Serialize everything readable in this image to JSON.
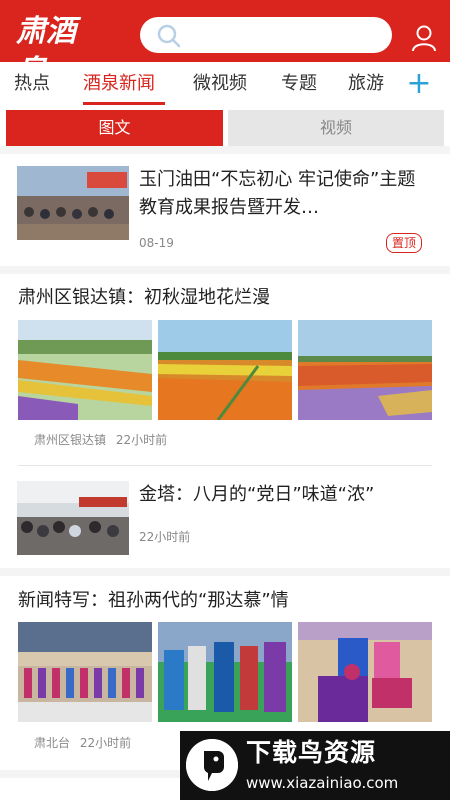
{
  "header": {
    "logo_text": "肃酒泉",
    "search_placeholder": ""
  },
  "categories": [
    {
      "label": "热点"
    },
    {
      "label": "酒泉新闻"
    },
    {
      "label": "微视频"
    },
    {
      "label": "专题"
    },
    {
      "label": "旅游"
    }
  ],
  "segments": {
    "left": "图文",
    "right": "视频"
  },
  "articles": [
    {
      "title": "玉门油田“不忘初心 牢记使命”主题教育成果报告暨开发…",
      "date": "08-19",
      "badge": "置顶"
    },
    {
      "title": "肃州区银达镇：初秋湿地花烂漫",
      "source": "肃州区银达镇",
      "time": "22小时前"
    },
    {
      "title": "金塔：八月的“党日”味道“浓”",
      "time": "22小时前"
    },
    {
      "title": "新闻特写：祖孙两代的“那达慕”情",
      "source": "肃北台",
      "time": "22小时前"
    }
  ],
  "watermark": {
    "title": "下载鸟资源",
    "url": "www.xiazainiao.com"
  },
  "colors": {
    "brand_red": "#d9251d",
    "accent_blue": "#2aa1d8"
  }
}
